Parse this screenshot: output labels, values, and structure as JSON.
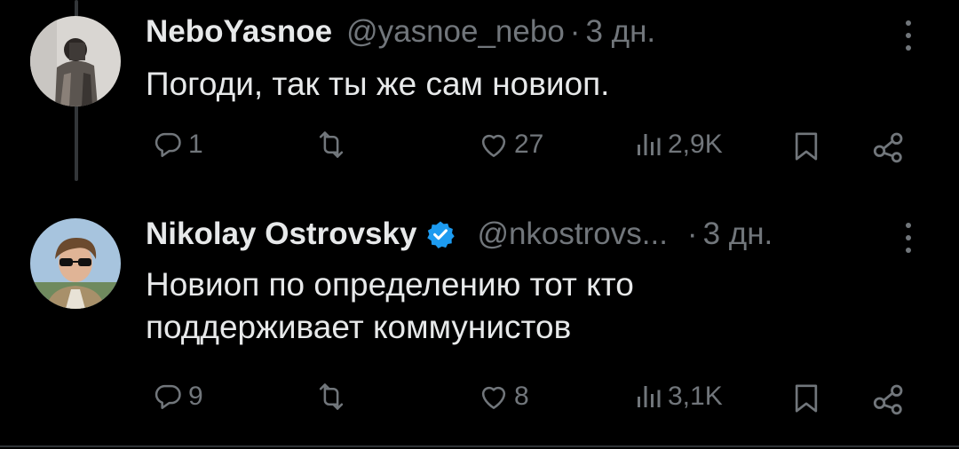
{
  "tweets": [
    {
      "author_name": "NeboYasnoe",
      "handle": "@yasnoe_nebo",
      "separator": "·",
      "time": "3 дн.",
      "text": "Погоди, так ты же сам новиоп.",
      "verified": false,
      "replies": "1",
      "likes": "27",
      "views": "2,9K"
    },
    {
      "author_name": "Nikolay Ostrovsky",
      "handle": "@nkostrovs...",
      "separator": "·",
      "time": "3 дн.",
      "text_lines": [
        "Новиоп по определению тот кто",
        "поддерживает коммунистов"
      ],
      "verified": true,
      "replies": "9",
      "likes": "8",
      "views": "3,1K"
    }
  ],
  "icons": [
    "reply-icon",
    "retweet-icon",
    "like-icon",
    "views-icon",
    "bookmark-icon",
    "share-icon",
    "more-icon",
    "verified-badge-icon"
  ],
  "colors": {
    "background": "#000000",
    "primary_text": "#e7e9ea",
    "secondary_text": "#71767b",
    "verified": "#1d9bf0"
  }
}
